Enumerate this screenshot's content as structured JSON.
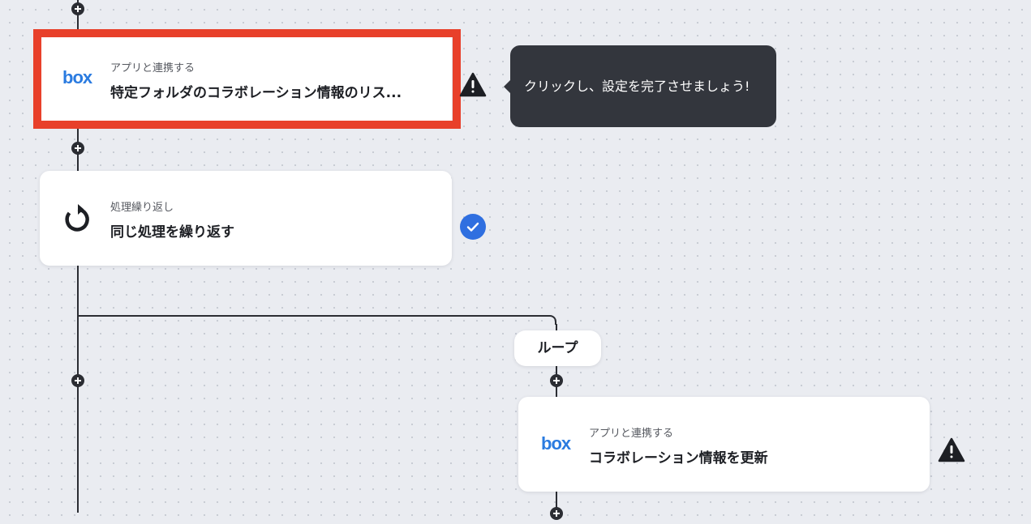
{
  "steps": [
    {
      "subtitle": "アプリと連携する",
      "title": "特定フォルダのコラボレーション情報のリス...",
      "icon": "box-logo",
      "logo_text": "box",
      "status": "warning"
    },
    {
      "subtitle": "処理繰り返し",
      "title": "同じ処理を繰り返す",
      "icon": "loop-arrow-icon",
      "status": "complete"
    },
    {
      "subtitle": "アプリと連携する",
      "title": "コラボレーション情報を更新",
      "icon": "box-logo",
      "logo_text": "box",
      "status": "warning"
    }
  ],
  "tooltip": {
    "text": "クリックし、設定を完了させましょう!"
  },
  "branch": {
    "label": "ループ"
  },
  "colors": {
    "highlight_border": "#e8402a",
    "tooltip_bg": "#33363d",
    "check_badge": "#2f6fe0",
    "box_brand": "#2a7be0",
    "connector": "#2b2d33"
  }
}
